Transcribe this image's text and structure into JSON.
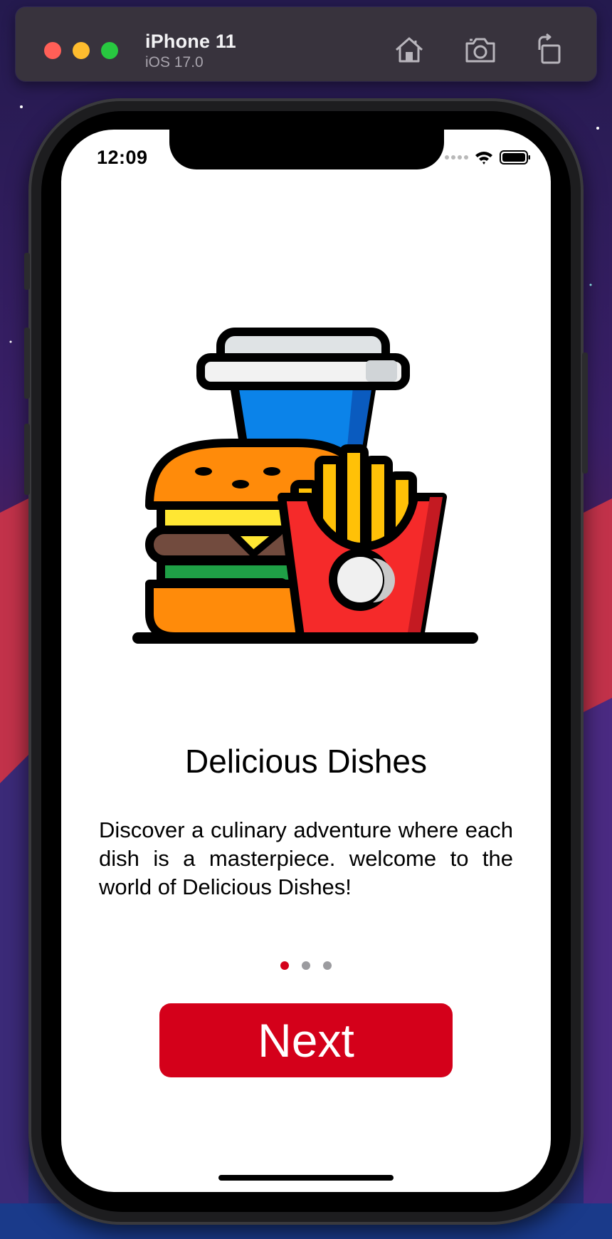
{
  "simulator": {
    "device_name": "iPhone 11",
    "os_version": "iOS 17.0",
    "buttons": {
      "home": "home-icon",
      "screenshot": "camera-icon",
      "rotate": "rotate-icon"
    }
  },
  "status_bar": {
    "time": "12:09",
    "icons": [
      "signal-dots-icon",
      "wifi-icon",
      "battery-icon"
    ]
  },
  "onboarding": {
    "illustration": "fast-food-illustration",
    "title": "Delicious Dishes",
    "description": "Discover a culinary adventure where each dish is a masterpiece. welcome to the world of Delicious Dishes!",
    "page_indicator": {
      "total": 3,
      "current": 1
    },
    "next_label": "Next"
  },
  "colors": {
    "accent": "#d4001a",
    "dot_inactive": "#9b9b9f",
    "screen_bg": "#ffffff",
    "sim_bar": "#38333d"
  }
}
